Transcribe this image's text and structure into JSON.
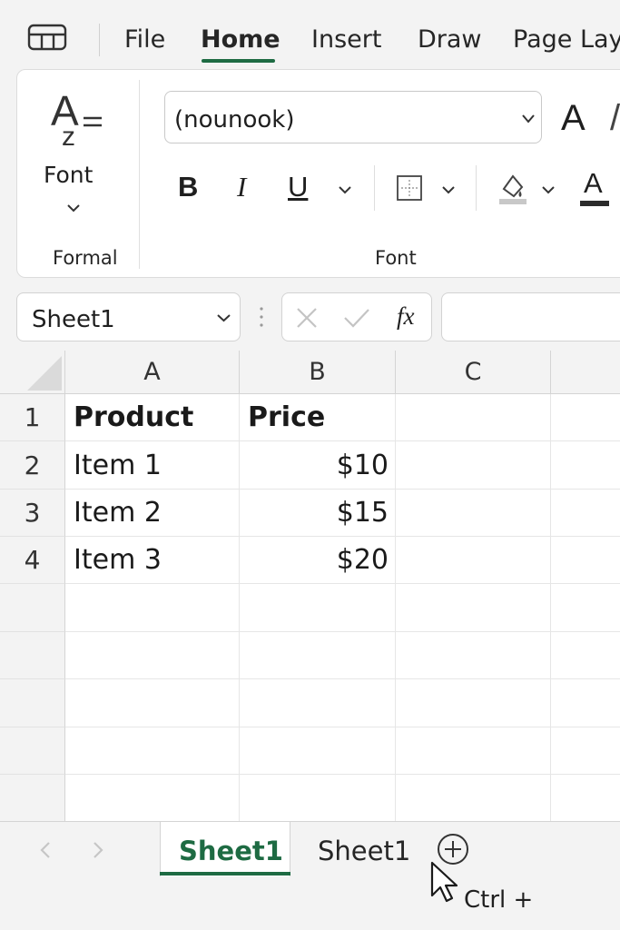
{
  "tabs": [
    {
      "label": "File",
      "active": false
    },
    {
      "label": "Home",
      "active": true
    },
    {
      "label": "Insert",
      "active": false
    },
    {
      "label": "Draw",
      "active": false
    },
    {
      "label": "Page Lay",
      "active": false
    }
  ],
  "ribbon": {
    "formal_group": {
      "button_label": "Font",
      "group_label": "Formal"
    },
    "font_group": {
      "font_name": "(nounook)",
      "group_label": "Font",
      "grow_font_glyph": "A",
      "bold": "B",
      "italic": "I",
      "underline": "U",
      "font_color_glyph": "A"
    }
  },
  "formula_bar": {
    "name_box": "Sheet1",
    "fx_label": "fx",
    "formula": ""
  },
  "sheet": {
    "columns": [
      "A",
      "B",
      "C"
    ],
    "rows": [
      "1",
      "2",
      "3",
      "4"
    ],
    "cells": [
      [
        "Product",
        "Price",
        ""
      ],
      [
        "Item 1",
        "$10",
        ""
      ],
      [
        "Item 2",
        "$15",
        ""
      ],
      [
        "Item 3",
        "$20",
        ""
      ]
    ]
  },
  "sheet_tabs": [
    {
      "label": "Sheet1",
      "active": true
    },
    {
      "label": "Sheet1",
      "active": false
    }
  ],
  "tooltip": "Ctrl +",
  "colors": {
    "accent": "#1e6b43",
    "background": "#f3f3f3",
    "grid_line": "#e6e6e6"
  },
  "icons": [
    "app-grid-icon",
    "font-styles-icon",
    "chevron-down-icon",
    "borders-icon",
    "fill-color-icon",
    "cancel-icon",
    "enter-icon",
    "add-sheet-icon",
    "mouse-cursor-icon"
  ]
}
